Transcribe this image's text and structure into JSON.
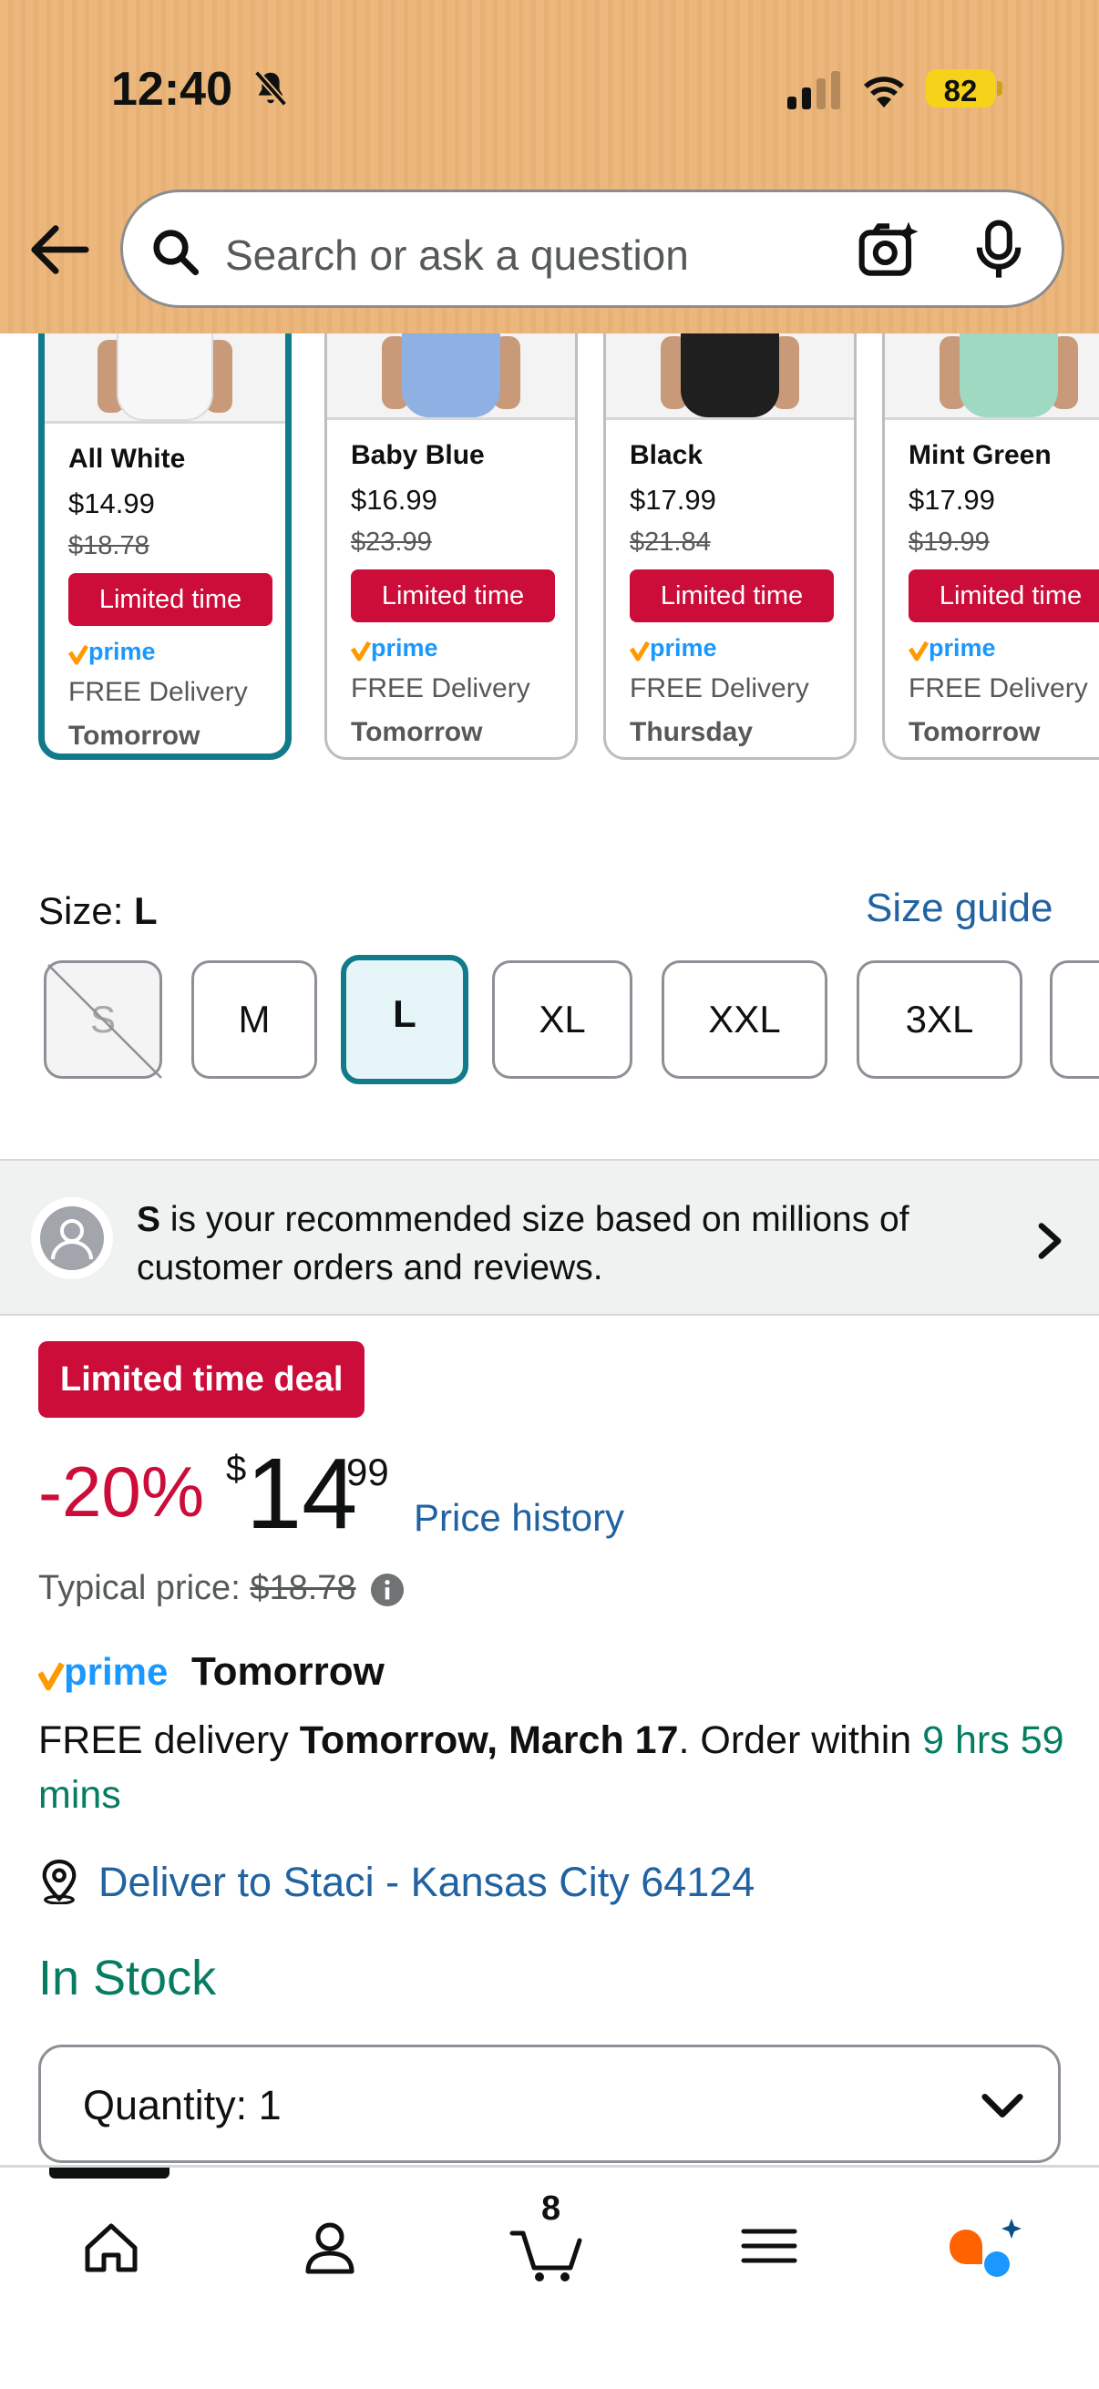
{
  "status_bar": {
    "time": "12:40",
    "battery": "82"
  },
  "search": {
    "placeholder": "Search or ask a question"
  },
  "variants": [
    {
      "name": "All White",
      "price": "$14.99",
      "list_price": "$18.78",
      "deal": "Limited time",
      "delivery": "FREE Delivery",
      "day": "Tomorrow",
      "selected": true
    },
    {
      "name": "Baby Blue",
      "price": "$16.99",
      "list_price": "$23.99",
      "deal": "Limited time",
      "delivery": "FREE Delivery",
      "day": "Tomorrow"
    },
    {
      "name": "Black",
      "price": "$17.99",
      "list_price": "$21.84",
      "deal": "Limited time",
      "delivery": "FREE Delivery",
      "day": "Thursday"
    },
    {
      "name": "Mint Green",
      "price": "$17.99",
      "list_price": "$19.99",
      "deal": "Limited time",
      "delivery": "FREE Delivery",
      "day": "Tomorrow"
    }
  ],
  "size": {
    "label": "Size:",
    "selected": "L",
    "guide": "Size guide",
    "options": [
      "S",
      "M",
      "L",
      "XL",
      "XXL",
      "3XL"
    ]
  },
  "recommendation": {
    "size": "S",
    "text": "is your recommended size based on millions of customer orders and reviews."
  },
  "deal": {
    "badge": "Limited time deal",
    "discount": "-20%",
    "price_symbol": "$",
    "price_whole": "14",
    "price_fraction": "99",
    "price_history": "Price history",
    "typical_label": "Typical price:",
    "typical_price": "$18.78"
  },
  "delivery": {
    "prime_day": "Tomorrow",
    "prefix": "FREE delivery",
    "date": "Tomorrow, March 17",
    "order_within": ". Order within",
    "countdown": "9 hrs 59 mins",
    "deliver_to": "Deliver to Staci - Kansas City 64124"
  },
  "stock": "In Stock",
  "quantity": {
    "label": "Quantity:",
    "value": "1"
  },
  "tabbar": {
    "cart_count": "8"
  },
  "colors": {
    "accent": "#117a8b",
    "deal_red": "#cc0c39",
    "link": "#2162a1",
    "success": "#067d62"
  }
}
